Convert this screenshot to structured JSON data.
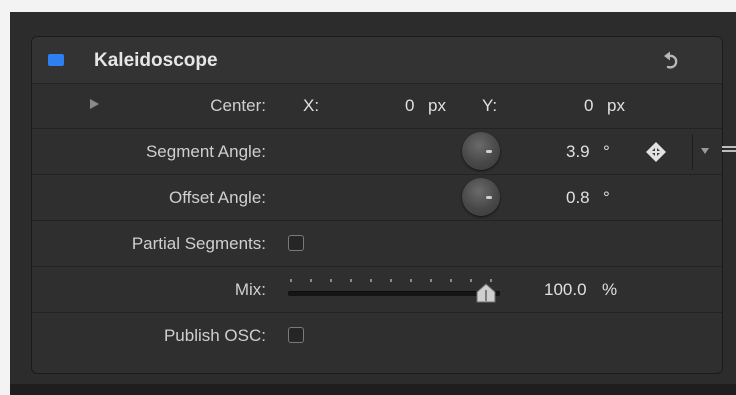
{
  "filter": {
    "title": "Kaleidoscope",
    "enabled": true,
    "accent_color": "#2e7ff0"
  },
  "params": {
    "center": {
      "label": "Center:",
      "x_label": "X:",
      "x_value": "0",
      "x_unit": "px",
      "y_label": "Y:",
      "y_value": "0",
      "y_unit": "px"
    },
    "segment_angle": {
      "label": "Segment Angle:",
      "value": "3.9",
      "unit": "°"
    },
    "offset_angle": {
      "label": "Offset Angle:",
      "value": "0.8",
      "unit": "°"
    },
    "partial_segments": {
      "label": "Partial Segments:",
      "checked": false
    },
    "mix": {
      "label": "Mix:",
      "value": "100.0",
      "unit": "%",
      "level": 1.0
    },
    "publish_osc": {
      "label": "Publish OSC:",
      "checked": false
    }
  },
  "icons": {
    "reset": "reset-arrow-icon",
    "keyframe": "keyframe-diamond-icon",
    "disclosure": "disclosure-triangle-icon",
    "menu": "parameter-menu-icon"
  }
}
